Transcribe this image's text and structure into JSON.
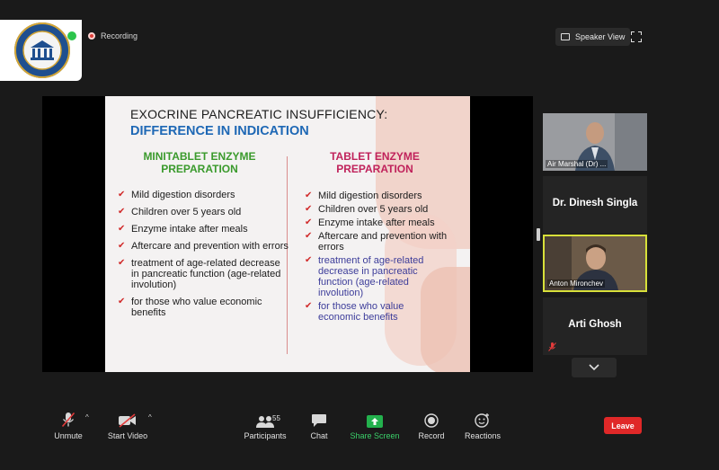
{
  "app": {
    "recording_label": "Recording",
    "speaker_view_label": "Speaker View"
  },
  "logo": {
    "text_top": "AMERICAN",
    "text_bottom": "SIAL"
  },
  "slide": {
    "title": "EXOCRINE PANCREATIC INSUFFICIENCY:",
    "subtitle": "DIFFERENCE IN INDICATION",
    "left_heading_line1": "MINITABLET ENZYME",
    "left_heading_line2": "PREPARATION",
    "right_heading_line1": "TABLET ENZYME",
    "right_heading_line2": "PREPARATION",
    "left_items": [
      "Mild digestion disorders",
      "Children over 5 years old",
      "Enzyme intake after meals",
      "Aftercare and prevention with errors",
      "treatment of age-related decrease in pancreatic function (age-related involution)",
      "for those who value economic benefits"
    ],
    "right_items": [
      "Mild digestion disorders",
      "Children over 5 years old",
      "Enzyme intake after meals",
      "Aftercare and prevention with errors",
      "treatment of age-related decrease in pancreatic function (age-related involution)",
      "for those who value economic benefits"
    ],
    "colors": {
      "title": "#1d1d1d",
      "subtitle": "#1e68b5",
      "left_heading": "#3a9a2c",
      "right_heading": "#c0225b",
      "check": "#d12a2a"
    }
  },
  "participants": [
    {
      "name": "Air Marshal (Dr) ...",
      "video": true
    },
    {
      "name": "Dr. Dinesh Singla",
      "video": false,
      "muted": false
    },
    {
      "name": "Anton Mironchev",
      "video": true,
      "active_speaker": true
    },
    {
      "name": "Arti Ghosh",
      "video": false,
      "muted": true
    }
  ],
  "toolbar": {
    "unmute_label": "Unmute",
    "start_video_label": "Start Video",
    "participants_label": "Participants",
    "participants_count": "55",
    "chat_label": "Chat",
    "share_screen_label": "Share Screen",
    "record_label": "Record",
    "reactions_label": "Reactions",
    "leave_label": "Leave"
  },
  "accent_colors": {
    "leave": "#e02828",
    "share": "#23b14d",
    "active_speaker_border": "#d8e03a"
  }
}
